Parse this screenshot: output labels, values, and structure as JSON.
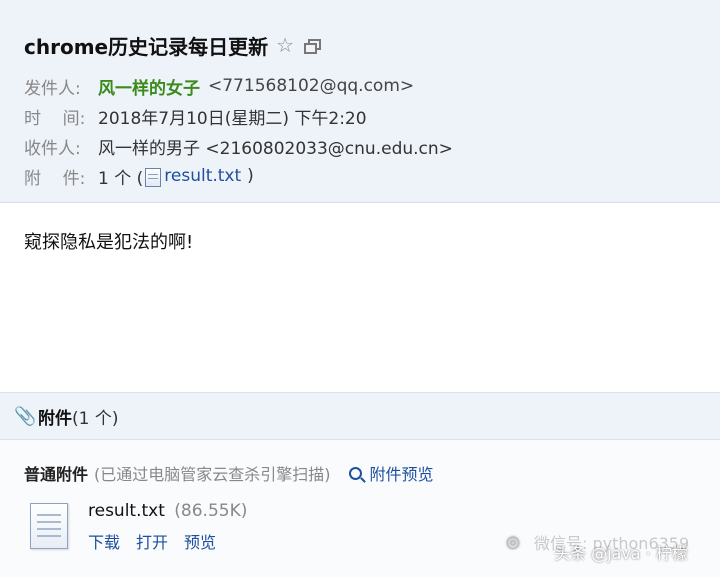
{
  "email": {
    "subject": "chrome历史记录每日更新",
    "from_label": "发件人:",
    "from_name": "风一样的女子",
    "from_addr": "<771568102@qq.com>",
    "time_label": "时    间:",
    "time_value": "2018年7月10日(星期二) 下午2:20",
    "to_label": "收件人:",
    "to_value": "风一样的男子 <2160802033@cnu.edu.cn>",
    "att_label": "附    件:",
    "att_count": "1 个 (",
    "att_file": "result.txt",
    "att_close": ")",
    "body": "窥探隐私是犯法的啊!"
  },
  "attachments": {
    "title": "附件",
    "count": "(1 个)",
    "normal_title": "普通附件",
    "scan_note": "(已通过电脑管家云查杀引擎扫描)",
    "preview_all": "附件预览",
    "file": {
      "name": "result.txt",
      "size": "(86.55K)",
      "actions": {
        "download": "下载",
        "open": "打开",
        "preview": "预览"
      }
    }
  },
  "watermark": {
    "line1": "微信号: python6359",
    "line2": "头条 @java · 柠檬"
  },
  "icons": {
    "star": "star-icon",
    "popout": "popout-icon",
    "clip": "paperclip-icon",
    "search": "magnifier-icon",
    "file": "file-icon"
  }
}
